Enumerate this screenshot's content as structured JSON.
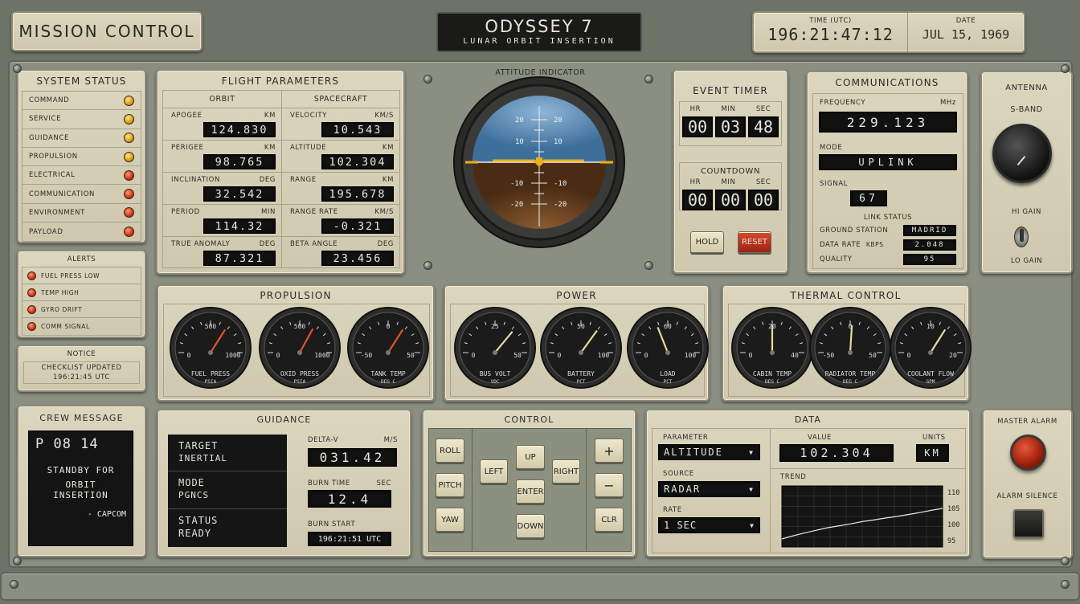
{
  "header": {
    "mission_control": "MISSION CONTROL",
    "craft": "ODYSSEY 7",
    "phase": "LUNAR ORBIT INSERTION",
    "time_label": "TIME (UTC)",
    "time_value": "196:21:47:12",
    "date_label": "DATE",
    "date_value": "JUL 15, 1969"
  },
  "system_status": {
    "title": "SYSTEM STATUS",
    "items": [
      {
        "label": "COMMAND",
        "lamp": "amber"
      },
      {
        "label": "SERVICE",
        "lamp": "amber"
      },
      {
        "label": "GUIDANCE",
        "lamp": "amber"
      },
      {
        "label": "PROPULSION",
        "lamp": "amber"
      },
      {
        "label": "ELECTRICAL",
        "lamp": "red"
      },
      {
        "label": "COMMUNICATION",
        "lamp": "red"
      },
      {
        "label": "ENVIRONMENT",
        "lamp": "red"
      },
      {
        "label": "PAYLOAD",
        "lamp": "red"
      }
    ]
  },
  "alerts": {
    "title": "ALERTS",
    "items": [
      "FUEL PRESS LOW",
      "TEMP HIGH",
      "GYRO DRIFT",
      "COMM SIGNAL"
    ]
  },
  "notice": {
    "title": "NOTICE",
    "line1": "CHECKLIST UPDATED",
    "line2": "196:21:45 UTC"
  },
  "flight": {
    "title": "FLIGHT PARAMETERS",
    "orbit_head": "ORBIT",
    "craft_head": "SPACECRAFT",
    "orbit": [
      {
        "label": "APOGEE",
        "unit": "KM",
        "value": "124.830"
      },
      {
        "label": "PERIGEE",
        "unit": "KM",
        "value": "98.765"
      },
      {
        "label": "INCLINATION",
        "unit": "DEG",
        "value": "32.542"
      },
      {
        "label": "PERIOD",
        "unit": "MIN",
        "value": "114.32"
      },
      {
        "label": "TRUE ANOMALY",
        "unit": "DEG",
        "value": "87.321"
      }
    ],
    "craft": [
      {
        "label": "VELOCITY",
        "unit": "KM/S",
        "value": "10.543"
      },
      {
        "label": "ALTITUDE",
        "unit": "KM",
        "value": "102.304"
      },
      {
        "label": "RANGE",
        "unit": "KM",
        "value": "195.678"
      },
      {
        "label": "RANGE RATE",
        "unit": "KM/S",
        "value": "-0.321"
      },
      {
        "label": "BETA ANGLE",
        "unit": "DEG",
        "value": "23.456"
      }
    ]
  },
  "attitude": {
    "title": "ATTITUDE INDICATOR",
    "ticks": [
      "20",
      "10",
      "10",
      "20",
      "-10",
      "-20",
      "-10",
      "-20"
    ]
  },
  "event_timer": {
    "title": "EVENT TIMER",
    "hr": "HR",
    "min": "MIN",
    "sec": "SEC",
    "v_hr": "00",
    "v_min": "03",
    "v_sec": "48"
  },
  "countdown": {
    "title": "COUNTDOWN",
    "hr": "HR",
    "min": "MIN",
    "sec": "SEC",
    "v_hr": "00",
    "v_min": "00",
    "v_sec": "00",
    "hold": "HOLD",
    "reset": "RESET"
  },
  "comms": {
    "title": "COMMUNICATIONS",
    "freq_label": "FREQUENCY",
    "freq_unit": "MHz",
    "freq": "229.123",
    "mode_label": "MODE",
    "mode": "UPLINK",
    "signal_label": "SIGNAL",
    "signal": "67",
    "link_title": "LINK STATUS",
    "gs_label": "GROUND STATION",
    "gs": "MADRID",
    "dr_label": "DATA RATE",
    "dr_unit": "KBPS",
    "dr": "2.048",
    "q_label": "QUALITY",
    "q": "95"
  },
  "antenna": {
    "title": "ANTENNA",
    "band": "S-BAND",
    "hi": "HI GAIN",
    "lo": "LO GAIN"
  },
  "propulsion": {
    "title": "PROPULSION",
    "gauges": [
      {
        "name": "FUEL PRESS",
        "unit": "PSIA",
        "min": "0",
        "mid": "500",
        "max": "1000",
        "level": 0.68
      },
      {
        "name": "OXID PRESS",
        "unit": "PSIA",
        "min": "0",
        "mid": "500",
        "max": "1000",
        "level": 0.66
      },
      {
        "name": "TANK TEMP",
        "unit": "DEG C",
        "min": "-50",
        "mid": "0",
        "max": "50",
        "level": 0.68
      }
    ]
  },
  "power": {
    "title": "POWER",
    "gauges": [
      {
        "name": "BUS VOLT",
        "unit": "VDC",
        "min": "0",
        "mid": "25",
        "max": "50",
        "level": 0.72
      },
      {
        "name": "BATTERY",
        "unit": "PCT",
        "min": "0",
        "mid": "50",
        "max": "100",
        "level": 0.7
      },
      {
        "name": "LOAD",
        "unit": "PCT",
        "min": "0",
        "mid": "60",
        "max": "100",
        "level": 0.38
      }
    ]
  },
  "thermal": {
    "title": "THERMAL CONTROL",
    "gauges": [
      {
        "name": "CABIN TEMP",
        "unit": "DEG C",
        "min": "0",
        "mid": "20",
        "max": "40",
        "level": 0.5
      },
      {
        "name": "RADIATOR TEMP",
        "unit": "DEG C",
        "min": "-50",
        "mid": "0",
        "max": "50",
        "level": 0.52
      },
      {
        "name": "COOLANT FLOW",
        "unit": "GPM",
        "min": "0",
        "mid": "10",
        "max": "20",
        "level": 0.68
      }
    ]
  },
  "crew": {
    "title": "CREW MESSAGE",
    "code": "P 08 14",
    "l1": "STANDBY FOR",
    "l2": "ORBIT INSERTION",
    "l3": "- CAPCOM"
  },
  "guidance": {
    "title": "GUIDANCE",
    "target_l": "TARGET",
    "target_v": "INERTIAL",
    "mode_l": "MODE",
    "mode_v": "PGNCS",
    "status_l": "STATUS",
    "status_v": "READY",
    "dv_l": "DELTA-V",
    "dv_u": "M/S",
    "dv": "031.42",
    "bt_l": "BURN TIME",
    "bt_u": "SEC",
    "bt": "12.4",
    "bs_l": "BURN START",
    "bs": "196:21:51 UTC"
  },
  "control": {
    "title": "CONTROL",
    "roll": "ROLL",
    "pitch": "PITCH",
    "yaw": "YAW",
    "left": "LEFT",
    "up": "UP",
    "right": "RIGHT",
    "enter": "ENTER",
    "down": "DOWN",
    "plus": "+",
    "minus": "−",
    "clr": "CLR"
  },
  "data": {
    "title": "DATA",
    "param_l": "PARAMETER",
    "param": "ALTITUDE",
    "source_l": "SOURCE",
    "source": "RADAR",
    "rate_l": "RATE",
    "rate": "1 SEC",
    "value_l": "VALUE",
    "value": "102.304",
    "units_l": "UNITS",
    "units": "KM",
    "trend_l": "TREND",
    "yticks": [
      "110",
      "105",
      "100",
      "95"
    ]
  },
  "alarm": {
    "master": "MASTER ALARM",
    "silence": "ALARM SILENCE"
  },
  "chart_data": {
    "type": "line",
    "title": "TREND",
    "ylim": [
      93,
      112
    ],
    "yticks": [
      110,
      105,
      100,
      95
    ],
    "values": [
      95.5,
      96.5,
      97.4,
      98.2,
      99.0,
      99.6,
      100.2,
      100.9,
      101.4,
      102.0,
      102.5,
      103.1,
      103.7,
      104.4,
      105.0
    ]
  }
}
